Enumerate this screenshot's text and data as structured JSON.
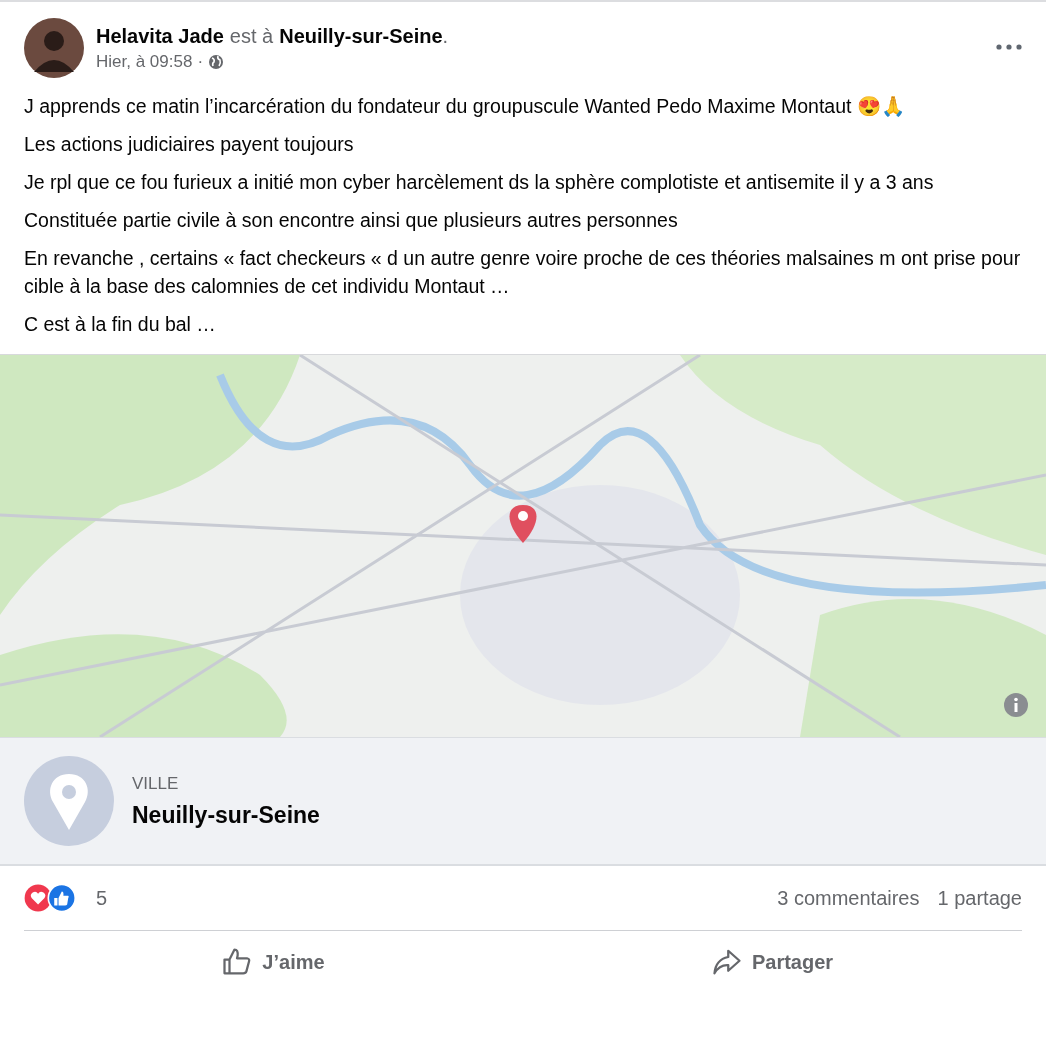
{
  "post": {
    "author": "Helavita Jade",
    "location_prefix": "est à",
    "location": "Neuilly-sur-Seine",
    "location_suffix": ".",
    "time": "Hier, à 09:58",
    "separator": "·",
    "paragraphs": [
      "J apprends ce matin l’incarcération du fondateur du groupuscule Wanted Pedo Maxime Montaut 😍🙏",
      "Les actions judiciaires payent toujours",
      "Je rpl que ce fou furieux a initié mon cyber harcèlement ds la sphère complotiste et antisemite il y a 3 ans",
      "Constituée partie civile à son encontre ainsi que plusieurs autres personnes",
      "En revanche , certains « fact checkeurs «  d un autre genre voire proche de ces théories malsaines  m ont prise pour cible à la base des calomnies de cet individu Montaut …",
      "C est à la fin du bal …"
    ]
  },
  "place": {
    "category": "VILLE",
    "name": "Neuilly-sur-Seine"
  },
  "stats": {
    "reactions": "5",
    "comments": "3 commentaires",
    "shares": "1 partage"
  },
  "actions": [
    {
      "kind": "like",
      "label": "J’aime"
    },
    {
      "kind": "share",
      "label": "Partager"
    }
  ]
}
